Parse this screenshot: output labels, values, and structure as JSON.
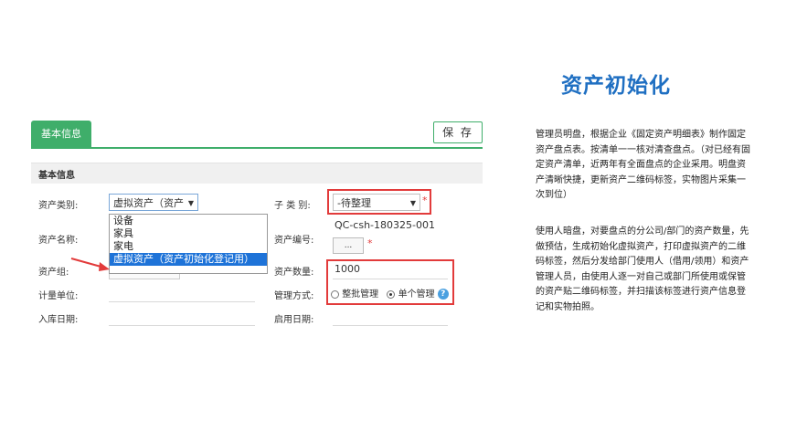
{
  "page": {
    "title": "资产初始化",
    "paragraph1": "管理员明盘，根据企业《固定资产明细表》制作固定资产盘点表。按清单一一核对清查盘点。（对已经有固定资产清单，近两年有全面盘点的企业采用。明盘资产清晰快捷，更新资产二维码标签，实物图片采集一次到位）",
    "paragraph2": "使用人暗盘，对要盘点的分公司/部门的资产数量，先做预估，生成初始化虚拟资产，打印虚拟资产的二维码标签，然后分发给部门使用人（借用/领用）和资产管理人员，由使用人逐一对自己或部门所使用或保管的资产贴二维码标签，并扫描该标签进行资产信息登记和实物拍照。"
  },
  "form": {
    "tab_label": "基本信息",
    "save_label": "保 存",
    "section_title": "基本信息",
    "labels": {
      "asset_category": "资产类别:",
      "asset_name": "资产名称:",
      "asset_group": "资产组:",
      "unit": "计量单位:",
      "in_date": "入库日期:",
      "subcategory": "子 类 别:",
      "asset_code": "资产编号:",
      "asset_count": "资产数量:",
      "manage_mode": "管理方式:",
      "start_date": "启用日期:"
    },
    "asset_category_value": "虚拟资产（资产",
    "subcategory_value": "-待整理",
    "asset_code_value": "QC-csh-180325-001",
    "dots_label": "...",
    "asset_count_value": "1000",
    "manage_options": [
      "整批管理",
      "单个管理"
    ],
    "manage_selected": "单个管理",
    "help_glyph": "?",
    "required_mark": "*",
    "dropdown_options": [
      "设备",
      "家具",
      "家电",
      "虚拟资产（资产初始化登记用）"
    ],
    "dropdown_selected_index": 3
  },
  "colors": {
    "accent_green": "#3fae6a",
    "title_blue": "#1f6fc2",
    "highlight_red": "#e23b3b",
    "selection_blue": "#1e73d8"
  }
}
